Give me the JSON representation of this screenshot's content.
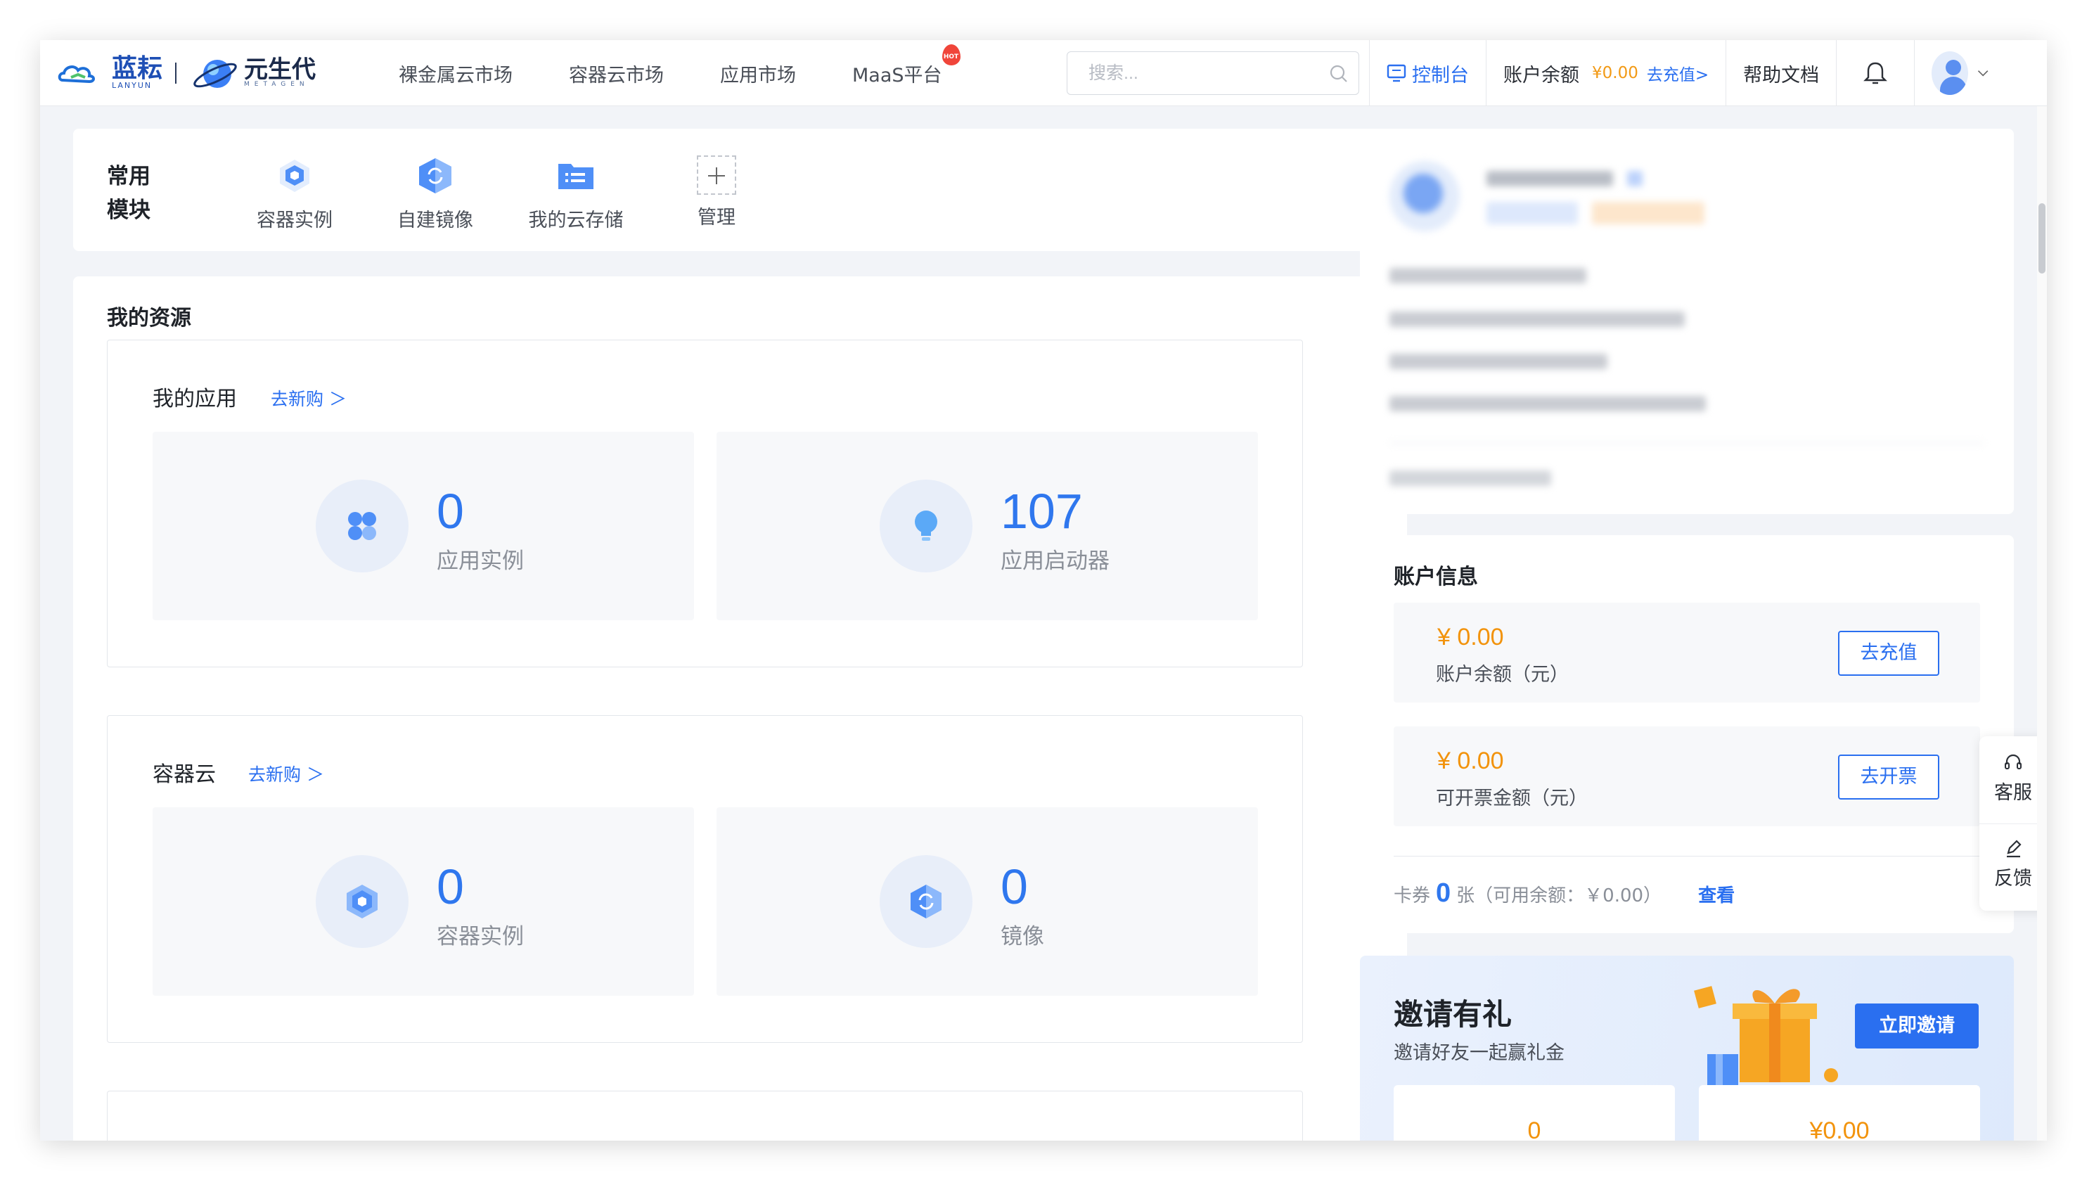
{
  "header": {
    "logo_lanyun": "蓝耘",
    "logo_lanyun_sub": "LANYUN",
    "logo_meta": "元生代",
    "logo_meta_sub": "METAGEN",
    "nav": [
      "裸金属云市场",
      "容器云市场",
      "应用市场",
      "MaaS平台"
    ],
    "hot_badge": "HOT",
    "search_placeholder": "搜索...",
    "console": "控制台",
    "balance_label": "账户余额",
    "balance_value": "¥0.00",
    "recharge_link": "去充值>",
    "docs": "帮助文档"
  },
  "quick_modules": {
    "title_line1": "常用",
    "title_line2": "模块",
    "items": [
      {
        "label": "容器实例",
        "icon": "cube-icon"
      },
      {
        "label": "自建镜像",
        "icon": "image-refresh-icon"
      },
      {
        "label": "我的云存储",
        "icon": "folder-list-icon"
      },
      {
        "label": "管理",
        "icon": "plus-icon"
      }
    ]
  },
  "resources": {
    "title": "我的资源",
    "apps": {
      "title": "我的应用",
      "buy": "去新购 ＞",
      "tiles": [
        {
          "value": "0",
          "label": "应用实例",
          "icon": "app-grid-icon"
        },
        {
          "value": "107",
          "label": "应用启动器",
          "icon": "lightbulb-icon"
        }
      ]
    },
    "container": {
      "title": "容器云",
      "buy": "去新购 ＞",
      "tiles": [
        {
          "value": "0",
          "label": "容器实例",
          "icon": "cube-icon"
        },
        {
          "value": "0",
          "label": "镜像",
          "icon": "image-refresh-icon"
        }
      ]
    }
  },
  "account": {
    "title": "账户信息",
    "rows": [
      {
        "amount": "¥ 0.00",
        "label": "账户余额（元）",
        "button": "去充值"
      },
      {
        "amount": "¥ 0.00",
        "label": "可开票金额（元）",
        "button": "去开票"
      }
    ],
    "coupon_prefix": "卡券",
    "coupon_count": "0",
    "coupon_suffix": "张（可用余额：￥0.00）",
    "coupon_view": "查看"
  },
  "invite": {
    "title": "邀请有礼",
    "subtitle": "邀请好友一起赢礼金",
    "button": "立即邀请",
    "stats": [
      "0",
      "¥0.00"
    ]
  },
  "float": {
    "service": "客服",
    "feedback": "反馈"
  },
  "colors": {
    "brand_blue": "#2a6ff0",
    "amount_orange": "#f2930c",
    "background": "#f2f4f8"
  }
}
